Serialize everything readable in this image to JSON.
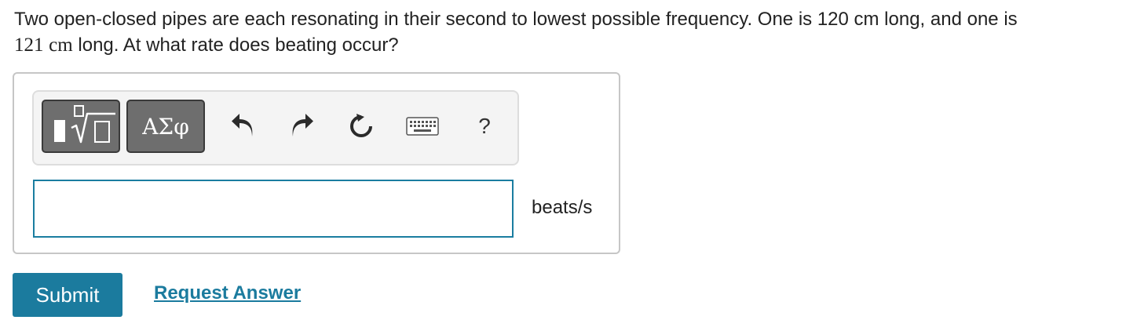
{
  "question": {
    "part1": "Two open-closed pipes are each resonating in their second to lowest possible frequency. One is 120 cm long, and one is",
    "math_value": "121",
    "math_unit": "cm",
    "part2": " long. At what rate does beating occur?"
  },
  "toolbar": {
    "greek_label": "ΑΣφ",
    "help_label": "?",
    "icons": [
      "template-icon",
      "greek-symbols-icon",
      "undo-icon",
      "redo-icon",
      "reset-icon",
      "keyboard-icon",
      "help-icon"
    ]
  },
  "answer": {
    "value": "",
    "placeholder": "",
    "unit": "beats/s"
  },
  "actions": {
    "submit_label": "Submit",
    "request_answer_label": "Request Answer"
  },
  "colors": {
    "accent": "#1b7b9e",
    "toolbar_button": "#6e6e6e",
    "input_border": "#1a7da0"
  }
}
